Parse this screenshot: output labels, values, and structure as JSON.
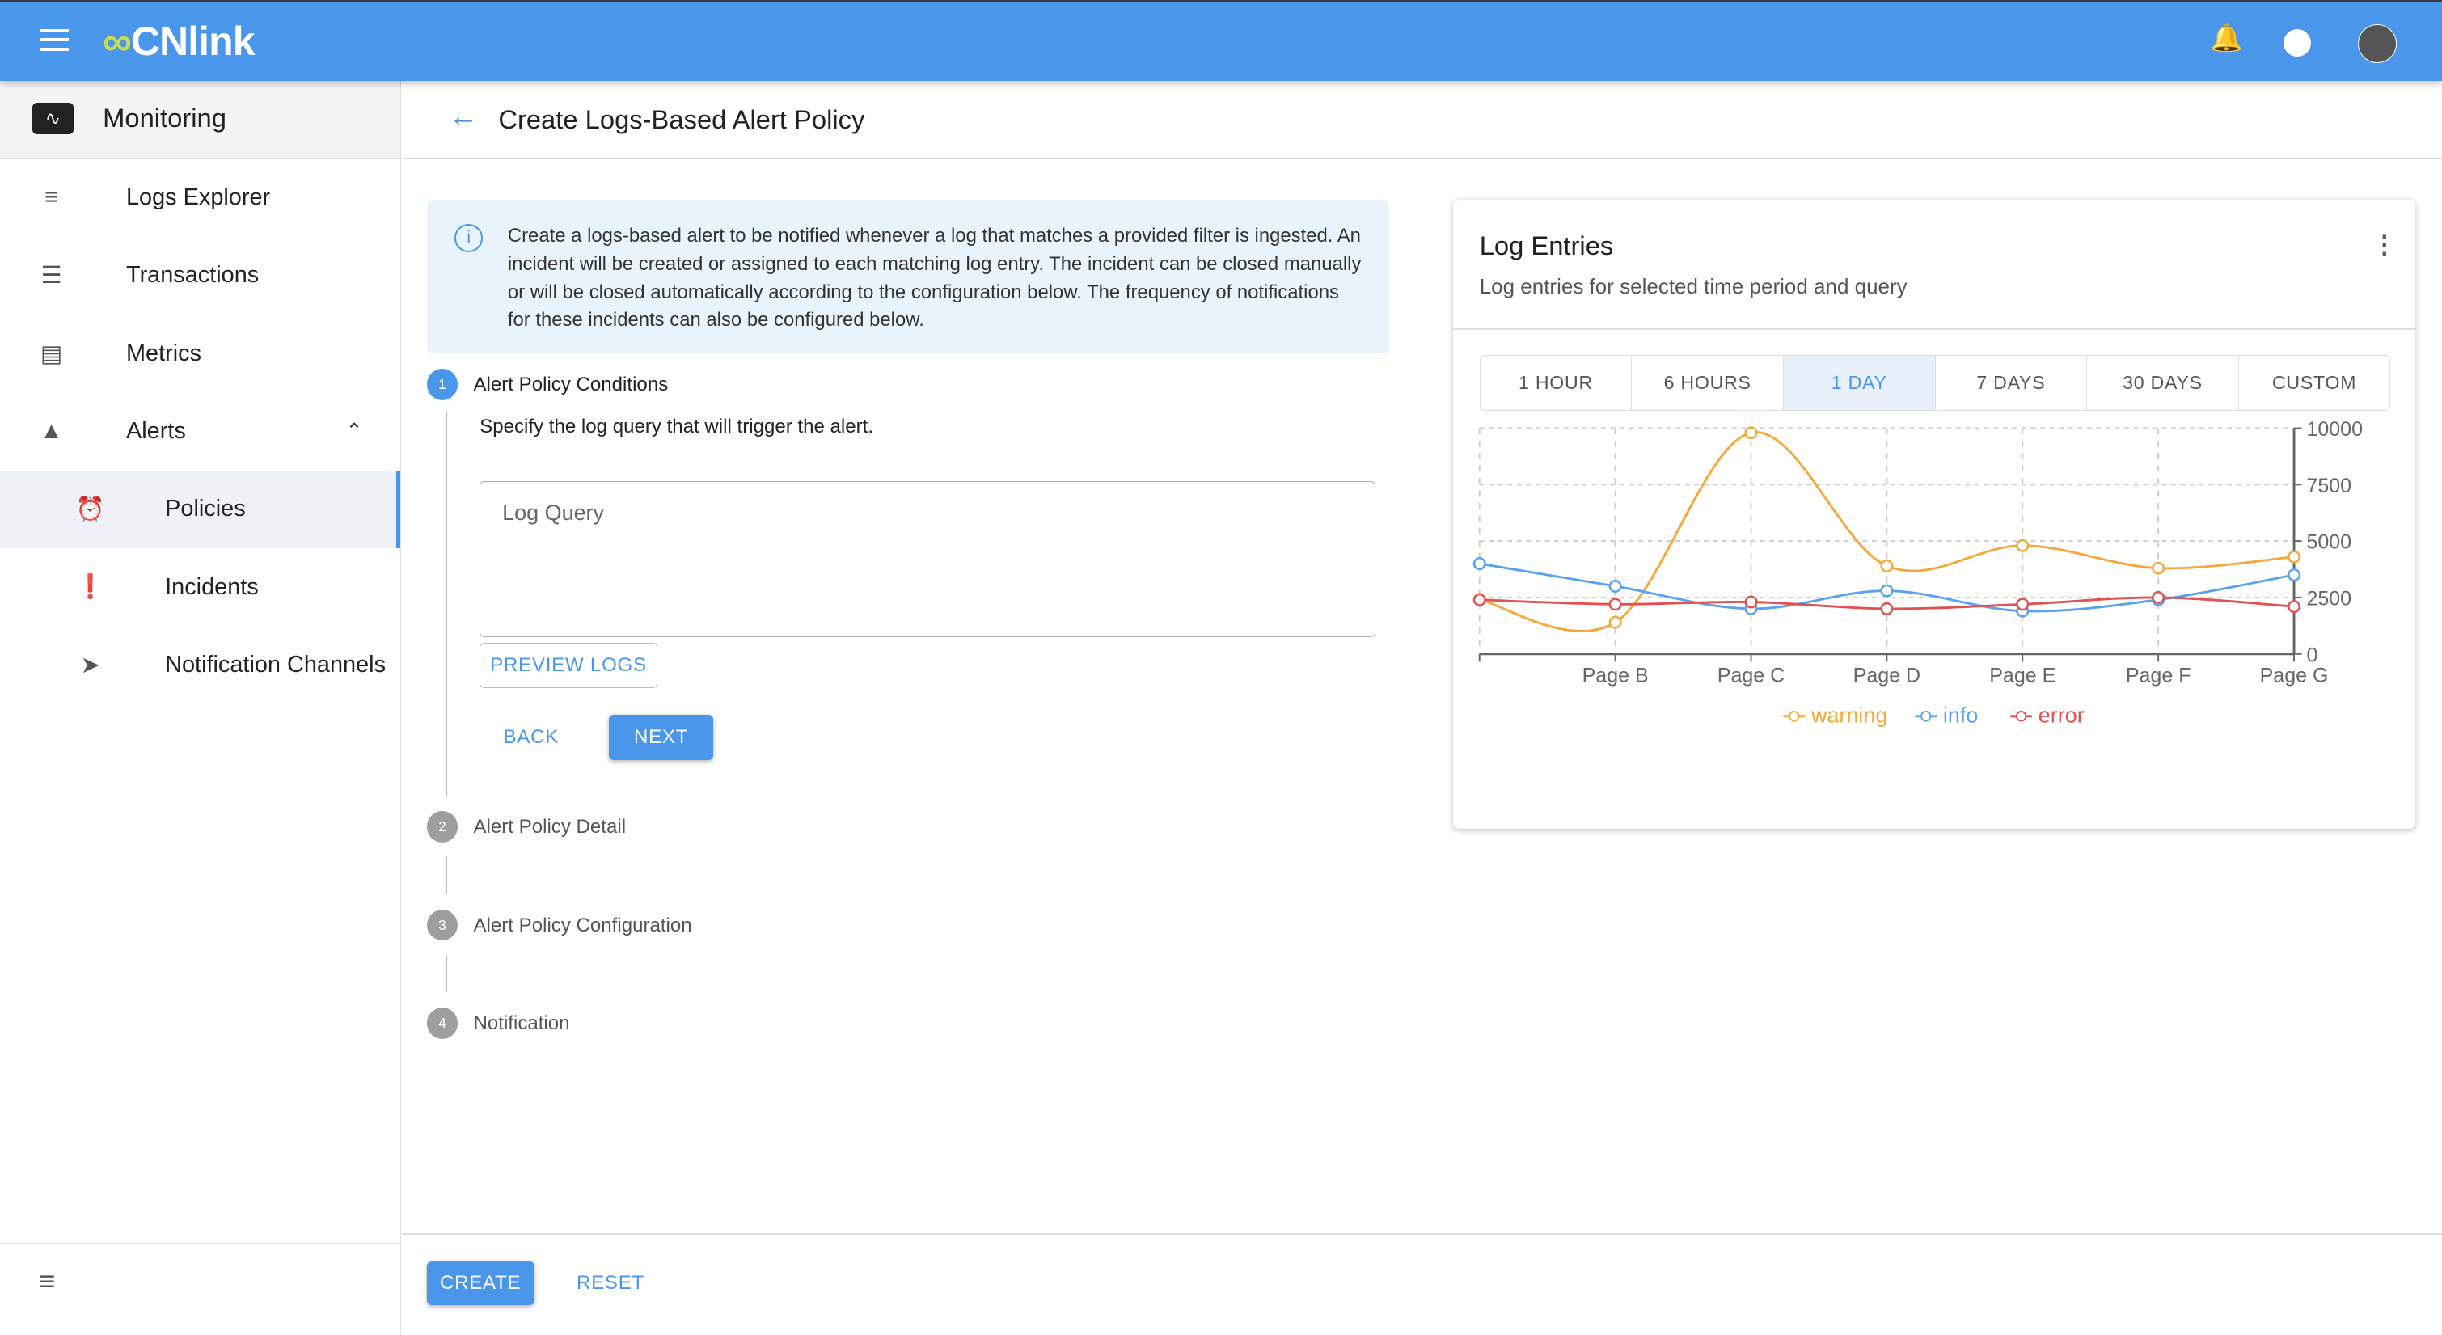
{
  "header": {
    "brand": "CNlink",
    "icons": [
      "menu-icon",
      "bell-icon",
      "palette-icon",
      "avatar"
    ]
  },
  "sidebar": {
    "title": "Monitoring",
    "items": [
      {
        "label": "Logs Explorer",
        "icon": "logs-search-icon"
      },
      {
        "label": "Transactions",
        "icon": "list-icon"
      },
      {
        "label": "Metrics",
        "icon": "bar-chart-icon"
      },
      {
        "label": "Alerts",
        "icon": "alert-bell-icon",
        "expanded": true
      },
      {
        "label": "Policies",
        "icon": "alarm-icon",
        "selected": true
      },
      {
        "label": "Incidents",
        "icon": "exclamation-icon"
      },
      {
        "label": "Notification Channels",
        "icon": "send-icon"
      }
    ]
  },
  "page": {
    "title": "Create Logs-Based Alert Policy"
  },
  "info": {
    "text": "Create a logs-based alert to be notified whenever a log that matches a provided filter is ingested. An incident will be created or assigned to each matching log entry. The incident can be closed manually or will be closed automatically according to the configuration below. The frequency of notifications for these incidents can also be configured below."
  },
  "stepper": {
    "steps": [
      {
        "num": "1",
        "label": "Alert Policy Conditions"
      },
      {
        "num": "2",
        "label": "Alert Policy Detail"
      },
      {
        "num": "3",
        "label": "Alert Policy Configuration"
      },
      {
        "num": "4",
        "label": "Notification"
      }
    ],
    "description": "Specify the log query that will trigger the alert.",
    "query_placeholder": "Log Query",
    "preview": "PREVIEW LOGS",
    "back": "BACK",
    "next": "NEXT"
  },
  "footer": {
    "create": "CREATE",
    "reset": "RESET"
  },
  "card": {
    "title": "Log Entries",
    "subtitle": "Log entries for selected time period and query",
    "tabs": [
      "1 HOUR",
      "6 HOURS",
      "1 DAY",
      "7 DAYS",
      "30 DAYS",
      "CUSTOM"
    ],
    "active_tab": "1 DAY"
  },
  "chart_data": {
    "type": "line",
    "categories": [
      "",
      "Page B",
      "Page C",
      "Page D",
      "Page E",
      "Page F",
      "Page G"
    ],
    "ylim": [
      0,
      10000
    ],
    "yticks": [
      "0",
      "2500",
      "5000",
      "7500",
      "10000"
    ],
    "y_axis_side": "right",
    "grid": true,
    "legend": "bottom",
    "series": [
      {
        "name": "warning",
        "color": "#f5a83a",
        "values": [
          2400,
          1400,
          9800,
          3900,
          4800,
          3800,
          4300
        ]
      },
      {
        "name": "info",
        "color": "#5aa2ef",
        "values": [
          4000,
          3000,
          2000,
          2800,
          1900,
          2400,
          3500
        ]
      },
      {
        "name": "error",
        "color": "#e05252",
        "values": [
          2400,
          2200,
          2300,
          2000,
          2200,
          2500,
          2100
        ]
      }
    ]
  }
}
